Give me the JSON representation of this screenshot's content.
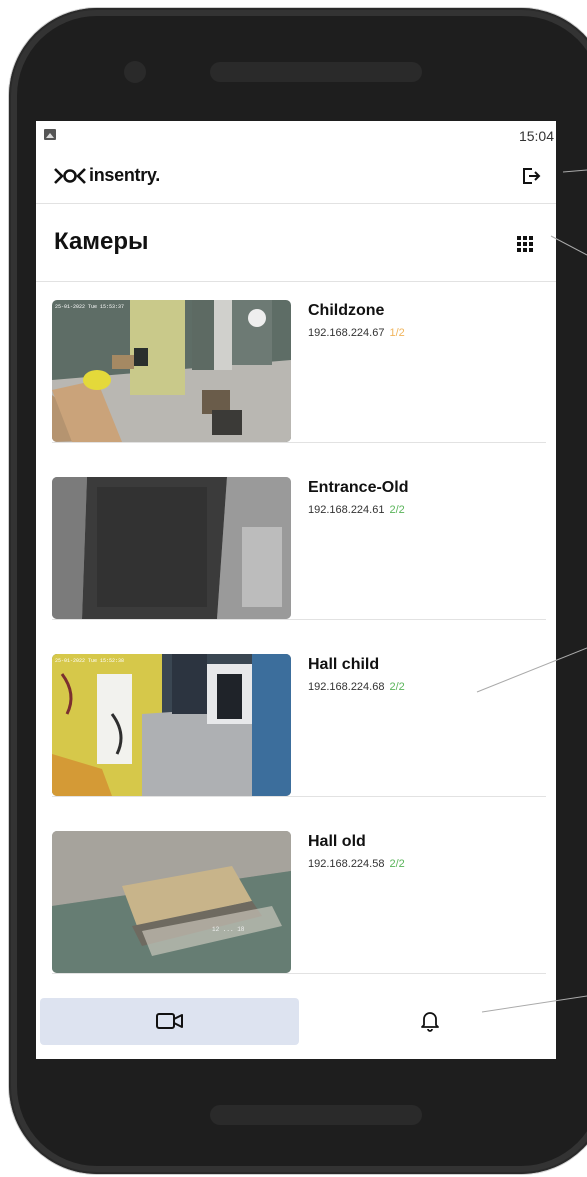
{
  "status_bar": {
    "time": "15:04",
    "notification_icon": "image-icon"
  },
  "header": {
    "logo_text": "insentry.",
    "logo_icon": "logo-mark-icon",
    "logout_icon": "logout-icon"
  },
  "section": {
    "title": "Камеры",
    "view_toggle_icon": "grid-icon"
  },
  "cameras": [
    {
      "name": "Childzone",
      "ip": "192.168.224.67",
      "status": "1/2",
      "status_color": "#f0b45c",
      "overlay_text": "25-01-2022 Tue 15:53:37"
    },
    {
      "name": "Entrance-Old",
      "ip": "192.168.224.61",
      "status": "2/2",
      "status_color": "#5ab45a",
      "overlay_text": ""
    },
    {
      "name": "Hall child",
      "ip": "192.168.224.68",
      "status": "2/2",
      "status_color": "#5ab45a",
      "overlay_text": "25-01-2022 Tue 15:52:38"
    },
    {
      "name": "Hall old",
      "ip": "192.168.224.58",
      "status": "2/2",
      "status_color": "#5ab45a",
      "overlay_text": "12 ... 18"
    }
  ],
  "bottom_nav": [
    {
      "id": "cameras",
      "icon": "video-camera-icon",
      "active": true
    },
    {
      "id": "events",
      "icon": "bell-icon",
      "active": false
    }
  ],
  "colors": {
    "active_tab": "#dde3f0",
    "divider": "#e2e2e2",
    "device_frame": "#333333"
  }
}
